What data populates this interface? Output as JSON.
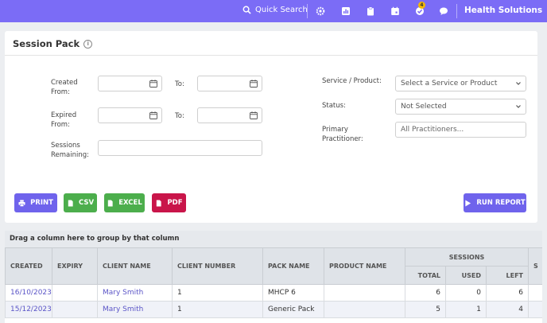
{
  "header": {
    "quick_search": "Quick Search",
    "notification_count": "4",
    "org_name": "Health Solutions",
    "icons": [
      "search-icon",
      "settings-icon",
      "chart-icon",
      "clipboard-icon",
      "calendar-icon",
      "tasks-icon",
      "chat-icon",
      "chevron-down-icon"
    ]
  },
  "page": {
    "title": "Session Pack"
  },
  "filters": {
    "created_from": "Created From:",
    "expired_from": "Expired From:",
    "to": "To:",
    "sessions_remaining": "Sessions Remaining:",
    "service_product": "Service / Product:",
    "service_placeholder": "Select a Service or Product",
    "status": "Status:",
    "status_value": "Not Selected",
    "primary_practitioner": "Primary Practitioner:",
    "practitioner_placeholder": "All Practitioners..."
  },
  "actions": {
    "print": "PRINT",
    "csv": "CSV",
    "excel": "EXCEL",
    "pdf": "PDF",
    "run_report": "RUN REPORT"
  },
  "colors": {
    "topbar": "#7b6cf6",
    "print": "#6f63ec",
    "csv": "#4cae4c",
    "excel": "#4cae4c",
    "pdf": "#c9154a",
    "run_report": "#6f63ec",
    "link": "#5b55c7"
  },
  "grid": {
    "group_hint": "Drag a column here to group by that column",
    "columns": {
      "created": "CREATED",
      "expiry": "EXPIRY",
      "client_name": "CLIENT NAME",
      "client_number": "CLIENT NUMBER",
      "pack_name": "PACK NAME",
      "product_name": "PRODUCT NAME",
      "sessions": "SESSIONS",
      "total": "TOTAL",
      "used": "USED",
      "left": "LEFT",
      "extra": "S"
    },
    "rows": [
      {
        "created": "16/10/2023",
        "expiry": "",
        "client_name": "Mary Smith",
        "client_number": "1",
        "pack_name": "MHCP 6",
        "product_name": "",
        "total": "6",
        "used": "0",
        "left": "6"
      },
      {
        "created": "15/12/2023",
        "expiry": "",
        "client_name": "Mary Smith",
        "client_number": "1",
        "pack_name": "Generic Pack",
        "product_name": "",
        "total": "5",
        "used": "1",
        "left": "4"
      }
    ]
  }
}
